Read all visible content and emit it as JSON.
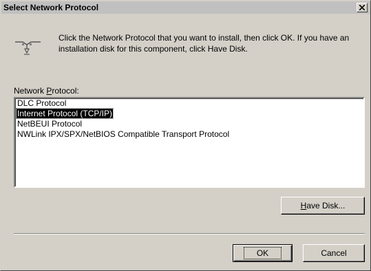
{
  "window": {
    "title": "Select Network Protocol"
  },
  "instructions": {
    "text": "Click the Network Protocol that you want to install, then click OK. If you have an installation disk for this component, click Have Disk."
  },
  "protocol_list": {
    "label_prefix": "Network ",
    "label_hotkey": "P",
    "label_suffix": "rotocol:",
    "items": [
      {
        "label": "DLC Protocol",
        "selected": false
      },
      {
        "label": "Internet Protocol (TCP/IP)",
        "selected": true
      },
      {
        "label": "NetBEUI Protocol",
        "selected": false
      },
      {
        "label": "NWLink IPX/SPX/NetBIOS Compatible Transport Protocol",
        "selected": false
      }
    ]
  },
  "buttons": {
    "have_disk_hotkey": "H",
    "have_disk_rest": "ave Disk...",
    "ok": "OK",
    "cancel": "Cancel"
  },
  "icons": {
    "network": "network-protocol-icon",
    "close": "close-icon"
  }
}
